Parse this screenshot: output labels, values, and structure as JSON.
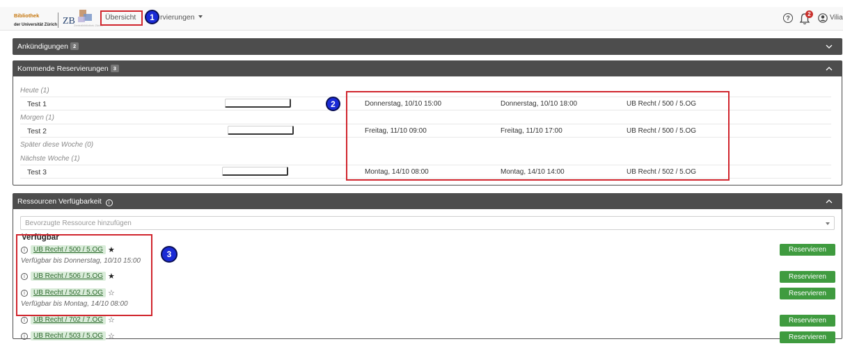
{
  "navbar": {
    "logo_uzh_line1": "Bibliothek",
    "logo_uzh_line2": "der Universität Zürich",
    "logo_zb": "ZB",
    "logo_zb_sub": "Zentralbibliothek Zürich",
    "overview_label": "Übersicht",
    "reservations_label": "rvierungen",
    "help_icon": "question-circle-icon",
    "notification_count": "2",
    "user_name": "Viliana",
    "marker_1": "1"
  },
  "announcements": {
    "title": "Ankündigungen",
    "count": "2",
    "toggle_icon": "chevron-down-icon"
  },
  "upcoming": {
    "title": "Kommende Reservierungen",
    "count": "3",
    "toggle_icon": "chevron-up-icon",
    "marker_2": "2",
    "groups": [
      {
        "label": "Heute (1)"
      },
      {
        "label": "Morgen (1)"
      },
      {
        "label": "Später diese Woche (0)"
      },
      {
        "label": "Nächste Woche (1)"
      }
    ],
    "rows": [
      {
        "name": "Test 1",
        "start": "Donnerstag, 10/10 15:00",
        "end": "Donnerstag, 10/10 18:00",
        "resource": "UB Recht / 500 / 5.OG"
      },
      {
        "name": "Test 2",
        "start": "Freitag, 11/10 09:00",
        "end": "Freitag, 11/10 17:00",
        "resource": "UB Recht / 500 / 5.OG"
      },
      {
        "name": "Test 3",
        "start": "Montag, 14/10 08:00",
        "end": "Montag, 14/10 14:00",
        "resource": "UB Recht / 502 / 5.OG"
      }
    ]
  },
  "resources": {
    "title": "Ressourcen Verfügbarkeit",
    "title_info_icon": "info-circle-icon",
    "toggle_icon": "chevron-up-icon",
    "search_placeholder": "Bevorzugte Ressource hinzufügen",
    "available_heading": "Verfügbar",
    "marker_3": "3",
    "reserve_label": "Reservieren",
    "items": [
      {
        "name": "UB Recht / 500 / 5.OG",
        "favorite": true,
        "note": "Verfügbar bis Donnerstag, 10/10 15:00"
      },
      {
        "name": "UB Recht / 506 / 5.OG",
        "favorite": true,
        "note": ""
      },
      {
        "name": "UB Recht / 502 / 5.OG",
        "favorite": false,
        "note": "Verfügbar bis Montag, 14/10 08:00"
      },
      {
        "name": "UB Recht / 702 / 7.OG",
        "favorite": false,
        "note": ""
      },
      {
        "name": "UB Recht / 503 / 5.OG",
        "favorite": false,
        "note": ""
      }
    ]
  },
  "colors": {
    "panel_header": "#4d4d4d",
    "reserve_button": "#3f9b3f",
    "highlight_box": "#d0242c",
    "marker": "#1a2bd6"
  }
}
